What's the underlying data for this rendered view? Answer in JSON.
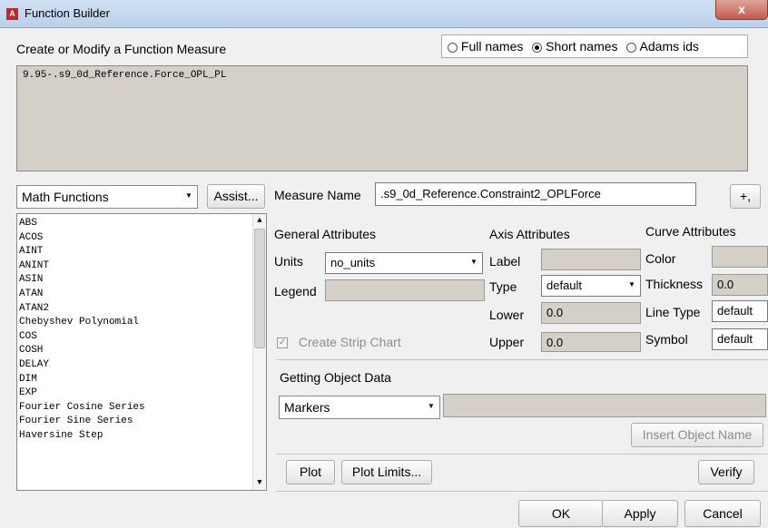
{
  "window": {
    "title": "Function Builder",
    "app_icon_letter": "A",
    "close_glyph": "x"
  },
  "header": {
    "section_label": "Create or Modify a Function Measure"
  },
  "name_mode": {
    "options": [
      "Full names",
      "Short names",
      "Adams ids"
    ],
    "selected": "Short names"
  },
  "expression": {
    "value": "9.95-.s9_0d_Reference.Force_OPL_PL"
  },
  "functions": {
    "category": "Math Functions",
    "assist_label": "Assist...",
    "items": [
      "ABS",
      "ACOS",
      "AINT",
      "ANINT",
      "ASIN",
      "ATAN",
      "ATAN2",
      "Chebyshev Polynomial",
      "COS",
      "COSH",
      "DELAY",
      "DIM",
      "EXP",
      "Fourier Cosine Series",
      "Fourier Sine Series",
      "Haversine Step"
    ]
  },
  "measure": {
    "name_label": "Measure Name",
    "name_value": ".s9_0d_Reference.Constraint2_OPLForce",
    "plus_label": "+,"
  },
  "general": {
    "title": "General Attributes",
    "units_label": "Units",
    "units_value": "no_units",
    "legend_label": "Legend",
    "legend_value": "",
    "strip_chart_label": "Create Strip Chart",
    "strip_chart_checked": true
  },
  "axis": {
    "title": "Axis Attributes",
    "label_label": "Label",
    "label_value": "",
    "type_label": "Type",
    "type_value": "default",
    "lower_label": "Lower",
    "lower_value": "0.0",
    "upper_label": "Upper",
    "upper_value": "0.0"
  },
  "curve": {
    "title": "Curve Attributes",
    "color_label": "Color",
    "color_value": "",
    "thickness_label": "Thickness",
    "thickness_value": "0.0",
    "line_type_label": "Line Type",
    "line_type_value": "default",
    "symbol_label": "Symbol",
    "symbol_value": "default"
  },
  "object_data": {
    "title": "Getting Object Data",
    "type_value": "Markers",
    "object_value": "",
    "insert_label": "Insert Object Name"
  },
  "buttons": {
    "plot": "Plot",
    "plot_limits": "Plot Limits...",
    "verify": "Verify",
    "ok": "OK",
    "apply": "Apply",
    "cancel": "Cancel"
  }
}
